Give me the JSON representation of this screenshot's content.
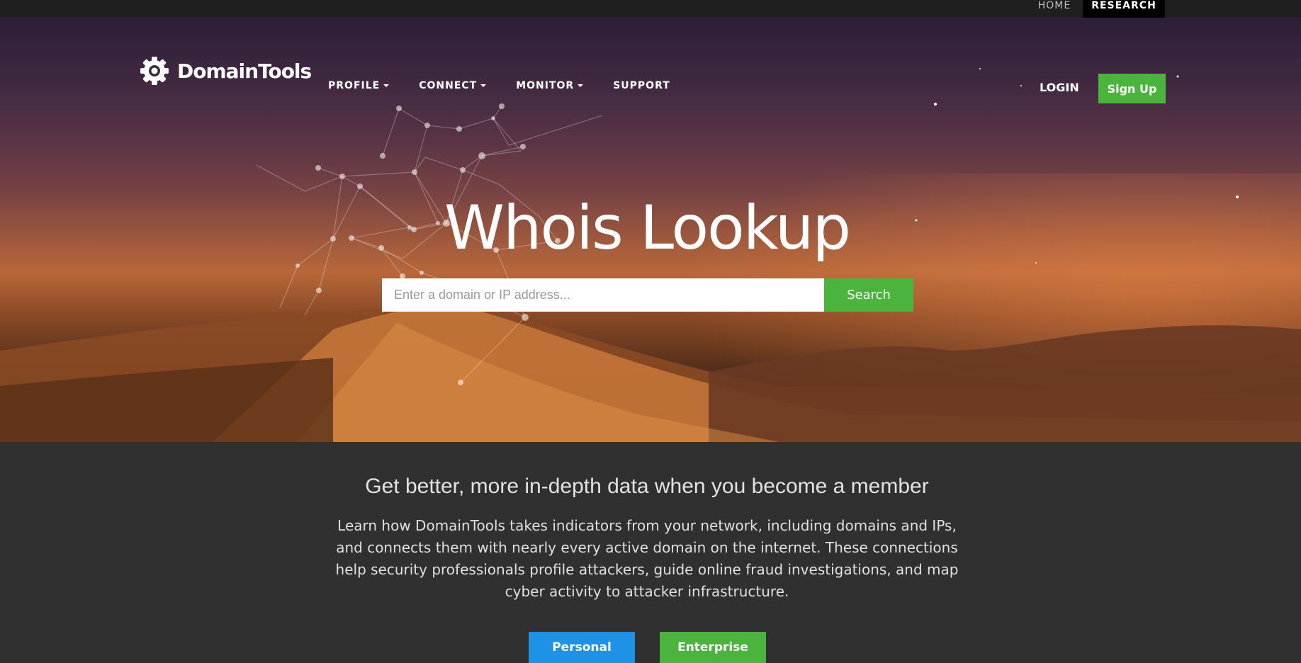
{
  "utility_bar": {
    "home_label": "HOME",
    "research_label": "RESEARCH"
  },
  "header": {
    "logo_text": "DomainTools",
    "nav": [
      {
        "label": "PROFILE",
        "has_dropdown": true
      },
      {
        "label": "CONNECT",
        "has_dropdown": true
      },
      {
        "label": "MONITOR",
        "has_dropdown": true
      },
      {
        "label": "SUPPORT",
        "has_dropdown": false
      }
    ],
    "login_label": "LOGIN",
    "signup_label": "Sign Up"
  },
  "hero": {
    "title": "Whois Lookup",
    "search_placeholder": "Enter a domain or IP address...",
    "search_value": "",
    "search_button": "Search"
  },
  "member": {
    "heading": "Get better, more in-depth data when you become a member",
    "body": "Learn how DomainTools takes indicators from your network, including domains and IPs, and connects them with nearly every active domain on the internet. These connections help security professionals profile attackers, guide online fraud investigations, and map cyber activity to attacker infrastructure.",
    "buttons": {
      "personal": "Personal",
      "enterprise": "Enterprise"
    }
  },
  "colors": {
    "accent_green": "#4bb43c",
    "accent_blue": "#1e93e6",
    "utility_bar": "#1f1f1f",
    "section_bg": "#303030"
  },
  "icons": {
    "logo": "gear-icon",
    "dropdown": "caret-down-icon"
  }
}
